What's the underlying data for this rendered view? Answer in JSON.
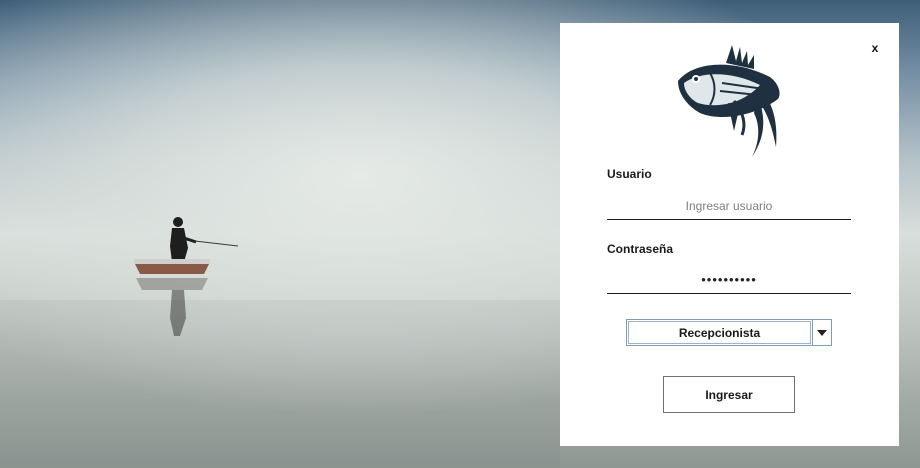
{
  "background": {
    "scene": "fisherman-on-boat-icon"
  },
  "login": {
    "close_label": "x",
    "logo_icon": "tuna-fish-icon",
    "username_label": "Usuario",
    "username_placeholder": "Ingresar usuario",
    "username_value": "",
    "password_label": "Contraseña",
    "password_value": "••••••••••",
    "role_selected": "Recepcionista",
    "role_dropdown_icon": "caret-down-icon",
    "submit_label": "Ingresar"
  },
  "colors": {
    "panel_bg": "#ffffff",
    "fish_dark": "#1f3140",
    "field_border": "#7f9db9"
  }
}
